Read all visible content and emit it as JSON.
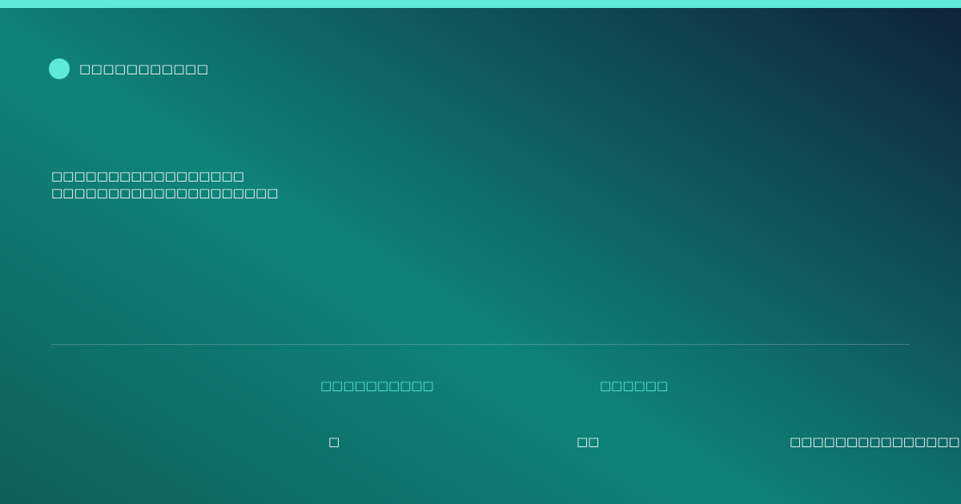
{
  "brand": {
    "name": "□□□□□□□□□□□",
    "icon": "brand-circle-icon",
    "accent_color": "#5eead4"
  },
  "headline": {
    "line1": "□□□□□□□□□□□□□□□□□",
    "line2": "□□□□□□□□□□□□□□□□□□□□"
  },
  "stats": {
    "label_1": "□□□□□□□□□□",
    "label_2": "□□□□□□",
    "value_1": "□",
    "value_2": "□□",
    "value_3": "□□□□□□□□□□□□□□□"
  },
  "colors": {
    "top_bar": "#5eead4",
    "accent": "#5eead4",
    "text": "#ffffff"
  }
}
